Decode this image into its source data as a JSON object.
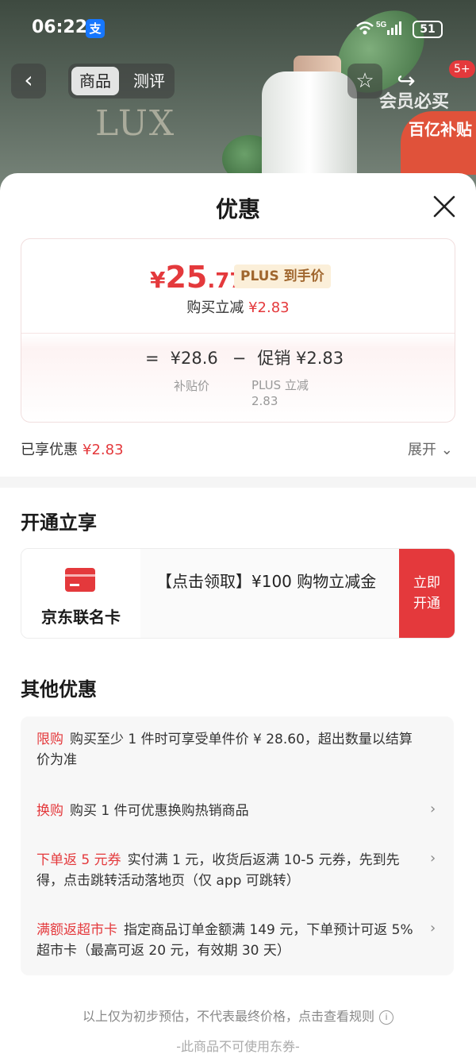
{
  "status_bar": {
    "time": "06:22",
    "alipay_icon": "支",
    "signal": "5G",
    "battery": "51"
  },
  "product_nav": {
    "back_icon": "chevron-left-icon",
    "tabs": [
      {
        "label": "商品",
        "active": true
      },
      {
        "label": "测评",
        "active": false
      }
    ],
    "badge": "5+",
    "member_text": "会员必买",
    "subsidy_text": "百亿补贴",
    "brand_text": "LUX"
  },
  "sheet": {
    "title": "优惠",
    "price": {
      "yen": "¥",
      "int": "25",
      "dec": ".77",
      "plus_badge": "PLUS 到手价"
    },
    "reduce": {
      "label": "购买立减",
      "value": "¥2.83"
    },
    "formula": {
      "eq": "=",
      "subsidy_price": "¥28.6",
      "minus": "−",
      "promo": "促销 ¥2.83"
    },
    "formula_labels": {
      "subsidy": "补贴价",
      "plus": "PLUS 立减\n2.83"
    },
    "enjoyed": {
      "label": "已享优惠",
      "value": "¥2.83"
    },
    "expand_label": "展开",
    "open_section_title": "开通立享",
    "card": {
      "name": "京东联名卡",
      "desc": "【点击领取】¥100 购物立减金",
      "button": "立即开通"
    },
    "other_section_title": "其他优惠",
    "promos": [
      {
        "tag": "限购",
        "text": "购买至少 1 件时可享受单件价 ¥ 28.60，超出数量以结算价为准",
        "arrow": false
      },
      {
        "tag": "换购",
        "text": "购买 1 件可优惠换购热销商品",
        "arrow": true
      },
      {
        "tag": "下单返 5 元券",
        "text": "实付满 1 元，收货后返满 10-5 元券，先到先得，点击跳转活动落地页（仅 app 可跳转）",
        "arrow": true
      },
      {
        "tag": "满额返超市卡",
        "text": "指定商品订单金额满 149 元，下单预计可返 5% 超市卡（最高可返 20 元，有效期 30 天）",
        "arrow": true
      }
    ],
    "footer_note": "以上仅为初步预估，不代表最终价格，点击查看规则",
    "footer_note2": "-此商品不可使用东券-"
  },
  "colors": {
    "accent": "#e4393c",
    "plus_bg": "#fbefd9",
    "plus_text": "#a0662e"
  }
}
